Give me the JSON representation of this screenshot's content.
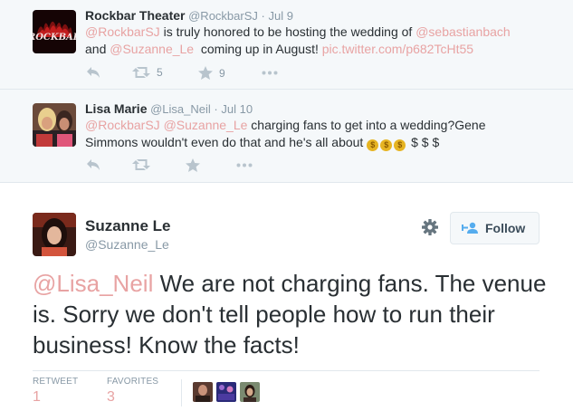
{
  "thread": [
    {
      "name": "Rockbar Theater",
      "handle": "@RockbarSJ",
      "dot": "·",
      "time": "Jul 9",
      "avatar_label": "ROCKBAR",
      "text": {
        "m1": "@RockbarSJ",
        "t1": " is truly honored to be hosting the wedding of ",
        "m2": "@sebastianbach",
        "t2": "and ",
        "m3": "@Suzanne_Le",
        "t3": "  coming up in August! ",
        "link": "pic.twitter.com/p682TcHt55"
      },
      "retweets": "5",
      "favorites": "9"
    },
    {
      "name": "Lisa Marie",
      "handle": "@Lisa_Neil",
      "dot": "·",
      "time": "Jul 10",
      "text": {
        "m1": "@RockbarSJ",
        "m2": "@Suzanne_Le",
        "t1": " charging fans to get into a wedding?Gene",
        "t2": "Simmons wouldn't even do that and he's all about ",
        "emoji": "$",
        "t3": " $ $ $"
      }
    }
  ],
  "main_tweet": {
    "name": "Suzanne Le",
    "handle": "@Suzanne_Le",
    "follow_label": "Follow",
    "mention": "@Lisa_Neil",
    "text": " We are not charging fans. The venue is. Sorry we don't tell people how to run their business! Know the facts!",
    "retweet_label": "RETWEET",
    "retweet_count": "1",
    "favorites_label": "FAVORITES",
    "favorites_count": "3"
  },
  "colors": {
    "mention": "#e8a3a3",
    "secondary_text": "#8899a6",
    "thread_background": "#f5f8fa"
  },
  "icons": [
    "reply-icon",
    "retweet-icon",
    "favorite-icon",
    "more-icon",
    "gear-icon",
    "follow-user-icon"
  ]
}
